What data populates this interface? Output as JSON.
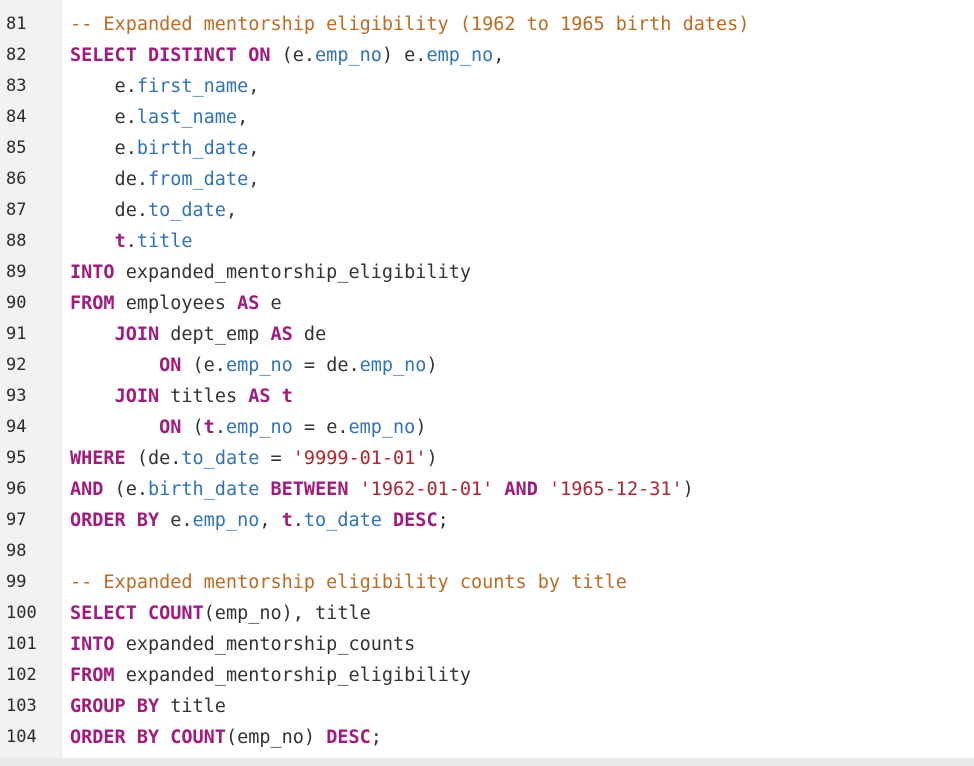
{
  "editor": {
    "lines": [
      {
        "n": "81",
        "tokens": [
          {
            "t": "cm",
            "v": "-- Expanded mentorship eligibility (1962 to 1965 birth dates)"
          }
        ]
      },
      {
        "n": "82",
        "tokens": [
          {
            "t": "kw",
            "v": "SELECT DISTINCT ON"
          },
          {
            "t": "plain",
            "v": " (e."
          },
          {
            "t": "prop",
            "v": "emp_no"
          },
          {
            "t": "plain",
            "v": ") e."
          },
          {
            "t": "prop",
            "v": "emp_no"
          },
          {
            "t": "plain",
            "v": ","
          }
        ]
      },
      {
        "n": "83",
        "tokens": [
          {
            "t": "plain",
            "v": "    e."
          },
          {
            "t": "prop",
            "v": "first_name"
          },
          {
            "t": "plain",
            "v": ","
          }
        ]
      },
      {
        "n": "84",
        "tokens": [
          {
            "t": "plain",
            "v": "    e."
          },
          {
            "t": "prop",
            "v": "last_name"
          },
          {
            "t": "plain",
            "v": ","
          }
        ]
      },
      {
        "n": "85",
        "tokens": [
          {
            "t": "plain",
            "v": "    e."
          },
          {
            "t": "prop",
            "v": "birth_date"
          },
          {
            "t": "plain",
            "v": ","
          }
        ]
      },
      {
        "n": "86",
        "tokens": [
          {
            "t": "plain",
            "v": "    de."
          },
          {
            "t": "prop",
            "v": "from_date"
          },
          {
            "t": "plain",
            "v": ","
          }
        ]
      },
      {
        "n": "87",
        "tokens": [
          {
            "t": "plain",
            "v": "    de."
          },
          {
            "t": "prop",
            "v": "to_date"
          },
          {
            "t": "plain",
            "v": ","
          }
        ]
      },
      {
        "n": "88",
        "tokens": [
          {
            "t": "plain",
            "v": "    "
          },
          {
            "t": "alias",
            "v": "t"
          },
          {
            "t": "plain",
            "v": "."
          },
          {
            "t": "prop",
            "v": "title"
          }
        ]
      },
      {
        "n": "89",
        "tokens": [
          {
            "t": "kw",
            "v": "INTO"
          },
          {
            "t": "plain",
            "v": " expanded_mentorship_eligibility"
          }
        ]
      },
      {
        "n": "90",
        "tokens": [
          {
            "t": "kw",
            "v": "FROM"
          },
          {
            "t": "plain",
            "v": " employees "
          },
          {
            "t": "kw",
            "v": "AS"
          },
          {
            "t": "plain",
            "v": " e"
          }
        ]
      },
      {
        "n": "91",
        "tokens": [
          {
            "t": "plain",
            "v": "    "
          },
          {
            "t": "kw",
            "v": "JOIN"
          },
          {
            "t": "plain",
            "v": " dept_emp "
          },
          {
            "t": "kw",
            "v": "AS"
          },
          {
            "t": "plain",
            "v": " de"
          }
        ]
      },
      {
        "n": "92",
        "tokens": [
          {
            "t": "plain",
            "v": "        "
          },
          {
            "t": "kw",
            "v": "ON"
          },
          {
            "t": "plain",
            "v": " (e."
          },
          {
            "t": "prop",
            "v": "emp_no"
          },
          {
            "t": "plain",
            "v": " = de."
          },
          {
            "t": "prop",
            "v": "emp_no"
          },
          {
            "t": "plain",
            "v": ")"
          }
        ]
      },
      {
        "n": "93",
        "tokens": [
          {
            "t": "plain",
            "v": "    "
          },
          {
            "t": "kw",
            "v": "JOIN"
          },
          {
            "t": "plain",
            "v": " titles "
          },
          {
            "t": "kw",
            "v": "AS"
          },
          {
            "t": "plain",
            "v": " "
          },
          {
            "t": "alias",
            "v": "t"
          }
        ]
      },
      {
        "n": "94",
        "tokens": [
          {
            "t": "plain",
            "v": "        "
          },
          {
            "t": "kw",
            "v": "ON"
          },
          {
            "t": "plain",
            "v": " ("
          },
          {
            "t": "alias",
            "v": "t"
          },
          {
            "t": "plain",
            "v": "."
          },
          {
            "t": "prop",
            "v": "emp_no"
          },
          {
            "t": "plain",
            "v": " = e."
          },
          {
            "t": "prop",
            "v": "emp_no"
          },
          {
            "t": "plain",
            "v": ")"
          }
        ]
      },
      {
        "n": "95",
        "tokens": [
          {
            "t": "kw",
            "v": "WHERE"
          },
          {
            "t": "plain",
            "v": " (de."
          },
          {
            "t": "prop",
            "v": "to_date"
          },
          {
            "t": "plain",
            "v": " = "
          },
          {
            "t": "str",
            "v": "'9999-01-01'"
          },
          {
            "t": "plain",
            "v": ")"
          }
        ]
      },
      {
        "n": "96",
        "tokens": [
          {
            "t": "kw",
            "v": "AND"
          },
          {
            "t": "plain",
            "v": " (e."
          },
          {
            "t": "prop",
            "v": "birth_date"
          },
          {
            "t": "plain",
            "v": " "
          },
          {
            "t": "kw",
            "v": "BETWEEN"
          },
          {
            "t": "plain",
            "v": " "
          },
          {
            "t": "str",
            "v": "'1962-01-01'"
          },
          {
            "t": "plain",
            "v": " "
          },
          {
            "t": "kw",
            "v": "AND"
          },
          {
            "t": "plain",
            "v": " "
          },
          {
            "t": "str",
            "v": "'1965-12-31'"
          },
          {
            "t": "plain",
            "v": ")"
          }
        ]
      },
      {
        "n": "97",
        "tokens": [
          {
            "t": "kw",
            "v": "ORDER BY"
          },
          {
            "t": "plain",
            "v": " e."
          },
          {
            "t": "prop",
            "v": "emp_no"
          },
          {
            "t": "plain",
            "v": ", "
          },
          {
            "t": "alias",
            "v": "t"
          },
          {
            "t": "plain",
            "v": "."
          },
          {
            "t": "prop",
            "v": "to_date"
          },
          {
            "t": "plain",
            "v": " "
          },
          {
            "t": "kw",
            "v": "DESC"
          },
          {
            "t": "plain",
            "v": ";"
          }
        ]
      },
      {
        "n": "98",
        "tokens": []
      },
      {
        "n": "99",
        "tokens": [
          {
            "t": "cm",
            "v": "-- Expanded mentorship eligibility counts by title"
          }
        ]
      },
      {
        "n": "100",
        "tokens": [
          {
            "t": "kw",
            "v": "SELECT"
          },
          {
            "t": "plain",
            "v": " "
          },
          {
            "t": "kw",
            "v": "COUNT"
          },
          {
            "t": "plain",
            "v": "(emp_no), title"
          }
        ]
      },
      {
        "n": "101",
        "tokens": [
          {
            "t": "kw",
            "v": "INTO"
          },
          {
            "t": "plain",
            "v": " expanded_mentorship_counts"
          }
        ]
      },
      {
        "n": "102",
        "tokens": [
          {
            "t": "kw",
            "v": "FROM"
          },
          {
            "t": "plain",
            "v": " expanded_mentorship_eligibility"
          }
        ]
      },
      {
        "n": "103",
        "tokens": [
          {
            "t": "kw",
            "v": "GROUP BY"
          },
          {
            "t": "plain",
            "v": " title"
          }
        ]
      },
      {
        "n": "104",
        "tokens": [
          {
            "t": "kw",
            "v": "ORDER BY"
          },
          {
            "t": "plain",
            "v": " "
          },
          {
            "t": "kw",
            "v": "COUNT"
          },
          {
            "t": "plain",
            "v": "(emp_no) "
          },
          {
            "t": "kw",
            "v": "DESC"
          },
          {
            "t": "plain",
            "v": ";"
          }
        ]
      }
    ]
  },
  "colors": {
    "keyword": "#a31a7e",
    "comment": "#c06a1f",
    "string": "#b5232f",
    "property": "#2f73b9",
    "text": "#333333",
    "gutter_bg": "#f2f2f2"
  }
}
